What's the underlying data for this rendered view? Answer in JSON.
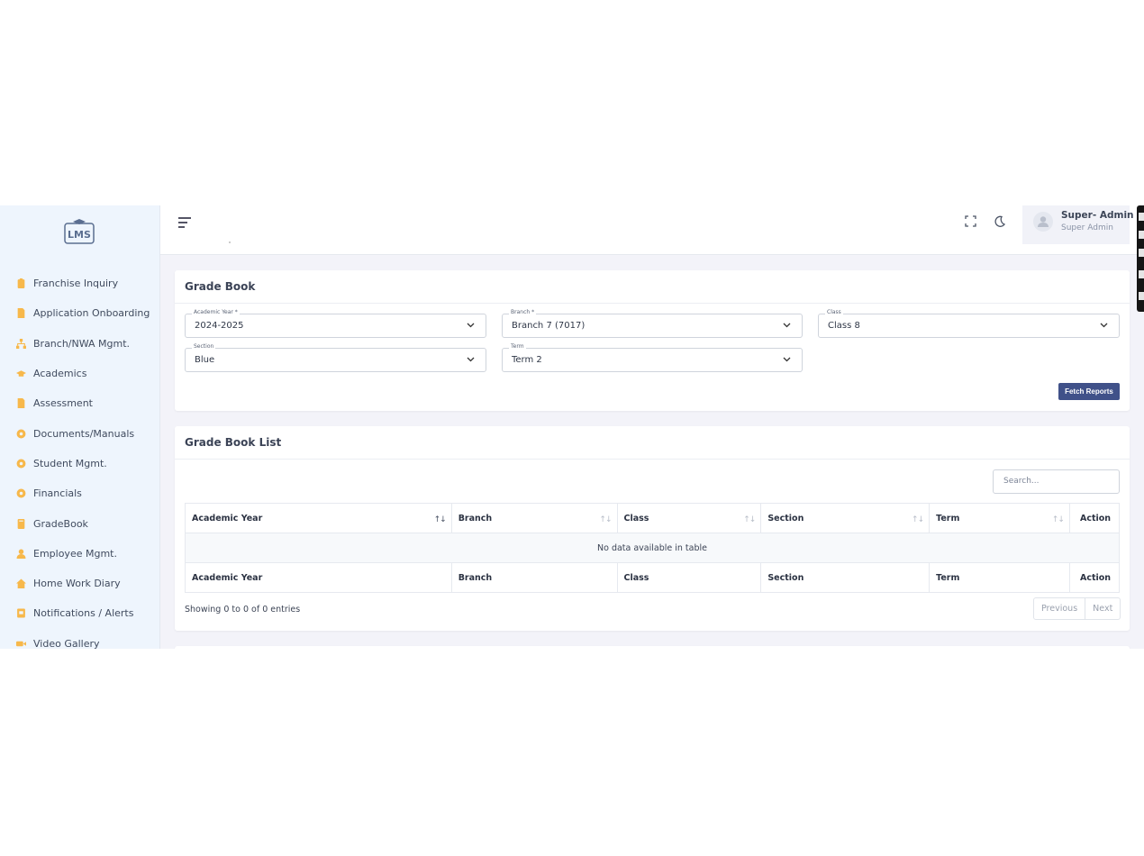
{
  "sidebar": {
    "logo_text": "LMS",
    "items": [
      {
        "label": "Franchise Inquiry",
        "icon": "clipboard-icon"
      },
      {
        "label": "Application Onboarding",
        "icon": "file-icon"
      },
      {
        "label": "Branch/NWA Mgmt.",
        "icon": "sitemap-icon"
      },
      {
        "label": "Academics",
        "icon": "graduation-cap-icon"
      },
      {
        "label": "Assessment",
        "icon": "document-icon"
      },
      {
        "label": "Documents/Manuals",
        "icon": "cog-icon"
      },
      {
        "label": "Student Mgmt.",
        "icon": "cog-icon"
      },
      {
        "label": "Financials",
        "icon": "cog-icon"
      },
      {
        "label": "GradeBook",
        "icon": "book-icon"
      },
      {
        "label": "Employee Mgmt.",
        "icon": "user-icon"
      },
      {
        "label": "Home Work Diary",
        "icon": "home-icon"
      },
      {
        "label": "Notifications / Alerts",
        "icon": "bell-icon"
      },
      {
        "label": "Video Gallery",
        "icon": "video-icon"
      }
    ],
    "icon_color": "#f7b84b"
  },
  "header": {
    "user_name": "Super- Admin",
    "user_role": "Super Admin"
  },
  "gradebook": {
    "title": "Grade Book",
    "fields": {
      "academic_year": {
        "label": "Academic Year *",
        "value": "2024-2025"
      },
      "branch": {
        "label": "Branch *",
        "value": "Branch 7 (7017)"
      },
      "class": {
        "label": "Class",
        "value": "Class 8"
      },
      "section": {
        "label": "Section",
        "value": "Blue"
      },
      "term": {
        "label": "Term",
        "value": "Term 2"
      }
    },
    "fetch_label": "Fetch Reports"
  },
  "list": {
    "title": "Grade Book List",
    "search_placeholder": "Search...",
    "columns": [
      "Academic Year",
      "Branch",
      "Class",
      "Section",
      "Term",
      "Action"
    ],
    "empty_text": "No data available in table",
    "showing": "Showing 0 to 0 of 0 entries",
    "prev_label": "Previous",
    "next_label": "Next"
  },
  "colors": {
    "primary": "#405189",
    "sidebar_bg": "#eef5fd",
    "page_bg": "#f3f3f9"
  }
}
